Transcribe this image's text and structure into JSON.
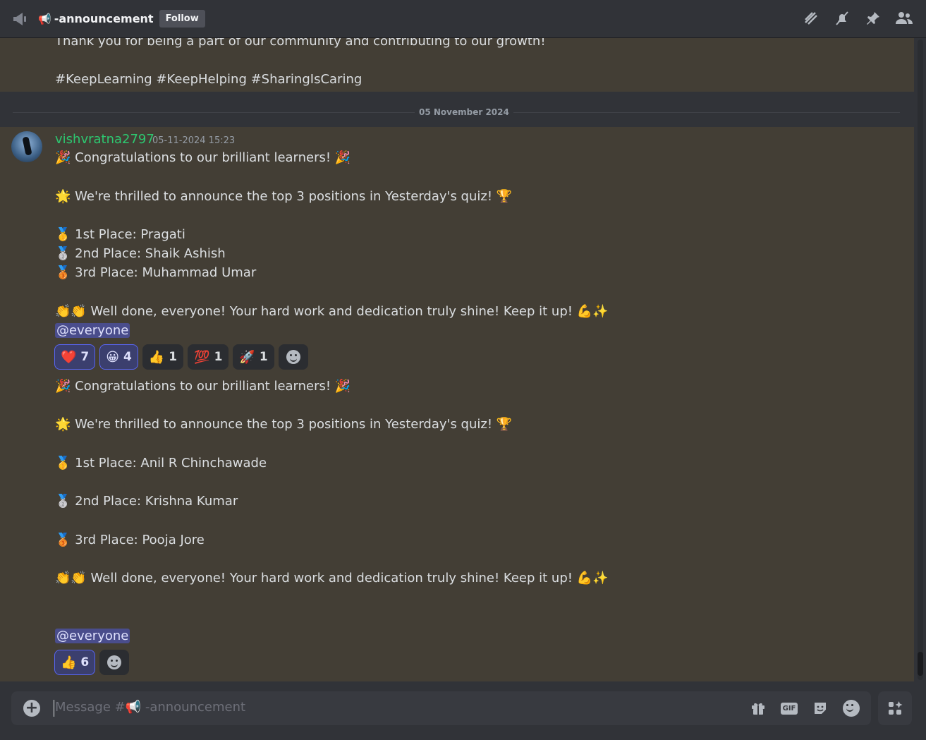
{
  "header": {
    "channel_icon": "megaphone-icon",
    "channel_emoji": "📢",
    "channel_name": "-announcement",
    "follow_label": "Follow",
    "actions": [
      "threads-icon",
      "mute-icon",
      "pin-icon",
      "members-icon"
    ]
  },
  "previous_message": {
    "line1": "Thank you for being a part of our community and contributing to our growth!",
    "line2": "#KeepLearning #KeepHelping #SharingIsCaring"
  },
  "divider": {
    "date": "05 November 2024"
  },
  "message": {
    "author": "vishvratna2797",
    "timestamp": "05-11-2024 15:23",
    "author_color": "#2dc770",
    "first": {
      "congrats": "🎉 Congratulations to our brilliant learners! 🎉",
      "announce": "🌟 We're thrilled to announce the top 3 positions in Yesterday's quiz! 🏆",
      "place1": "🥇 1st Place: Pragati",
      "place2": "🥈 2nd Place: Shaik Ashish",
      "place3": "🥉 3rd Place: Muhammad Umar",
      "well_done": "👏👏 Well done, everyone! Your hard work and dedication truly shine! Keep it up! 💪✨",
      "mention": "@everyone",
      "reactions": [
        {
          "emoji": "❤️",
          "count": "7",
          "mine": true
        },
        {
          "emoji": "😀",
          "count": "4",
          "mine": true
        },
        {
          "emoji": "👍",
          "count": "1",
          "mine": false
        },
        {
          "emoji": "💯",
          "count": "1",
          "mine": false
        },
        {
          "emoji": "🚀",
          "count": "1",
          "mine": false
        }
      ]
    },
    "second": {
      "congrats": "🎉 Congratulations to our brilliant learners! 🎉",
      "announce": "🌟 We're thrilled to announce the top 3 positions in Yesterday's quiz! 🏆",
      "place1": "🥇 1st Place: Anil R Chinchawade",
      "place2": "🥈 2nd Place: Krishna Kumar",
      "place3": "🥉 3rd Place: Pooja Jore",
      "well_done": "👏👏 Well done, everyone! Your hard work and dedication truly shine! Keep it up! 💪✨",
      "mention": "@everyone",
      "reactions": [
        {
          "emoji": "👍",
          "count": "6",
          "mine": true
        }
      ]
    }
  },
  "composer": {
    "placeholder": "Message #📢 -announcement",
    "gif_label": "GIF",
    "actions": [
      "gift-icon",
      "gif-icon",
      "sticker-icon",
      "emoji-icon"
    ]
  },
  "colors": {
    "highlight_bg": "#433e35",
    "mention_bg": "#4a4d8c",
    "accent": "#5865f2"
  }
}
